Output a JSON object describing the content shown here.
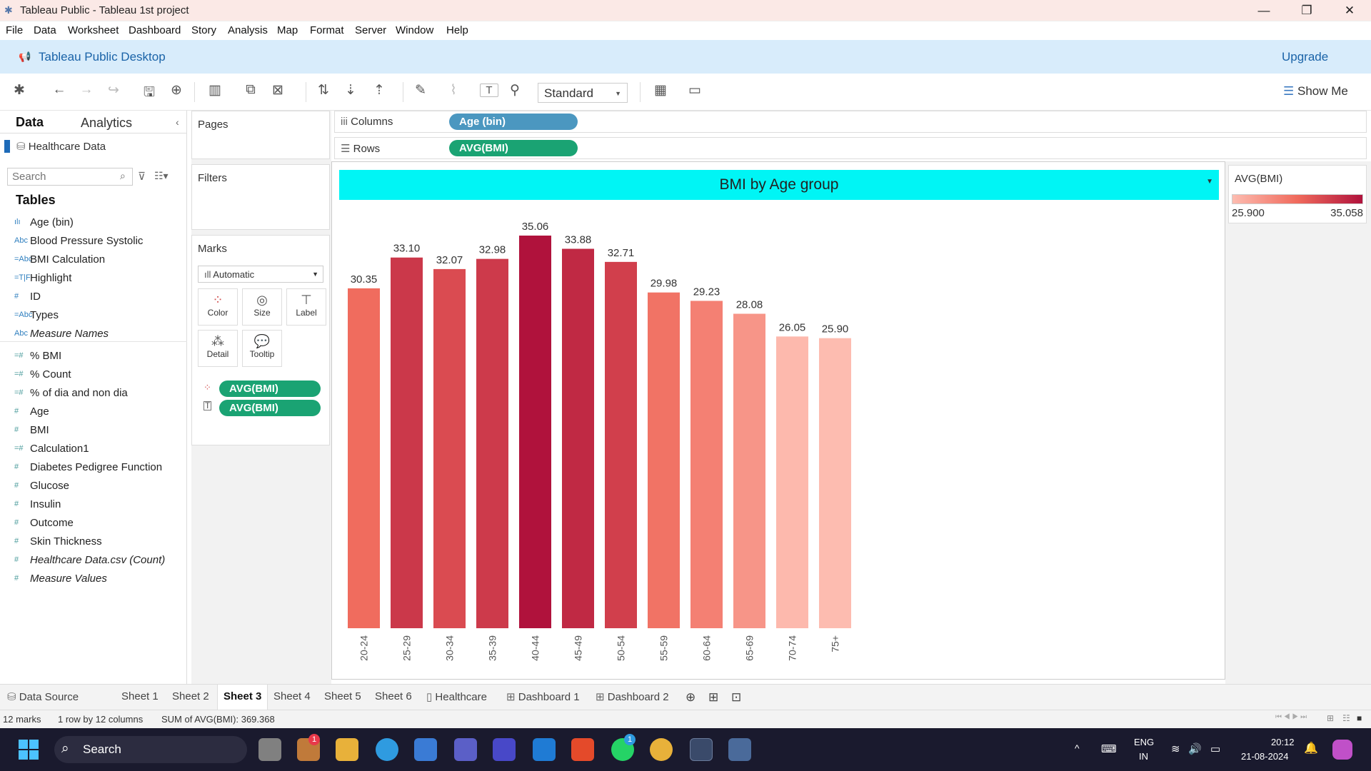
{
  "window": {
    "title": "Tableau Public - Tableau 1st project"
  },
  "menu": [
    "File",
    "Data",
    "Worksheet",
    "Dashboard",
    "Story",
    "Analysis",
    "Map",
    "Format",
    "Server",
    "Window",
    "Help"
  ],
  "banner": {
    "product": "Tableau Public Desktop",
    "upgrade": "Upgrade"
  },
  "toolbar": {
    "fit": "Standard",
    "show_me": "Show Me"
  },
  "left_pane": {
    "tab_data": "Data",
    "tab_analytics": "Analytics",
    "datasource": "Healthcare Data",
    "search_placeholder": "Search",
    "tables_heading": "Tables",
    "dimensions": [
      {
        "icon": "bin-icon",
        "label": "Age (bin)"
      },
      {
        "icon": "abc-icon",
        "label": "Blood Pressure Systolic"
      },
      {
        "icon": "calc-abc-icon",
        "label": "BMI Calculation"
      },
      {
        "icon": "calc-tf-icon",
        "label": "Highlight"
      },
      {
        "icon": "hash-icon",
        "label": "ID"
      },
      {
        "icon": "calc-abc-icon",
        "label": "Types"
      },
      {
        "icon": "abc-icon",
        "label": "Measure Names"
      }
    ],
    "measures": [
      {
        "icon": "calc-hash-icon",
        "label": "% BMI"
      },
      {
        "icon": "calc-hash-icon",
        "label": "% Count"
      },
      {
        "icon": "calc-hash-icon",
        "label": "% of dia and non dia"
      },
      {
        "icon": "hash-icon",
        "label": "Age"
      },
      {
        "icon": "hash-icon",
        "label": "BMI"
      },
      {
        "icon": "calc-hash-icon",
        "label": "Calculation1"
      },
      {
        "icon": "hash-icon",
        "label": "Diabetes Pedigree Function"
      },
      {
        "icon": "hash-icon",
        "label": "Glucose"
      },
      {
        "icon": "hash-icon",
        "label": "Insulin"
      },
      {
        "icon": "hash-icon",
        "label": "Outcome"
      },
      {
        "icon": "hash-icon",
        "label": "Skin Thickness"
      },
      {
        "icon": "hash-icon",
        "label": "Healthcare Data.csv (Count)"
      },
      {
        "icon": "hash-icon",
        "label": "Measure Values"
      }
    ]
  },
  "shelves": {
    "pages": "Pages",
    "filters": "Filters",
    "marks": "Marks",
    "mark_type": "Automatic",
    "mark_buttons": [
      "Color",
      "Size",
      "Label",
      "Detail",
      "Tooltip"
    ],
    "mark_pills": [
      "AVG(BMI)",
      "AVG(BMI)"
    ],
    "columns_label": "Columns",
    "columns_pill": "Age (bin)",
    "rows_label": "Rows",
    "rows_pill": "AVG(BMI)"
  },
  "legend": {
    "title": "AVG(BMI)",
    "min_label": "25.900",
    "max_label": "35.058",
    "min_color": "#fdbcb0",
    "max_color": "#b0123c"
  },
  "chart_data": {
    "type": "bar",
    "title": "BMI by Age group",
    "categories": [
      "20-24",
      "25-29",
      "30-34",
      "35-39",
      "40-44",
      "45-49",
      "50-54",
      "55-59",
      "60-64",
      "65-69",
      "70-74",
      "75+"
    ],
    "values": [
      30.35,
      33.1,
      32.07,
      32.98,
      35.06,
      33.88,
      32.71,
      29.98,
      29.23,
      28.08,
      26.05,
      25.9
    ],
    "value_labels": [
      "30.35",
      "33.10",
      "32.07",
      "32.98",
      "35.06",
      "33.88",
      "32.71",
      "29.98",
      "29.23",
      "28.08",
      "26.05",
      "25.90"
    ],
    "color_range": [
      25.9,
      35.058
    ],
    "ylim": [
      0,
      35.06
    ],
    "grid": false,
    "xlabel": "",
    "ylabel": ""
  },
  "sheet_tabs": [
    "Data Source",
    "Sheet 1",
    "Sheet 2",
    "Sheet 3",
    "Sheet 4",
    "Sheet 5",
    "Sheet 6",
    "Healthcare",
    "Dashboard 1",
    "Dashboard 2"
  ],
  "active_tab": "Sheet 3",
  "status": {
    "marks": "12 marks",
    "dims": "1 row by 12 columns",
    "sum": "SUM of AVG(BMI): 369.368"
  },
  "taskbar": {
    "search": "Search",
    "lang1": "ENG",
    "lang2": "IN",
    "time": "20:12",
    "date": "21-08-2024",
    "badge1": "1",
    "badge2": "1"
  }
}
